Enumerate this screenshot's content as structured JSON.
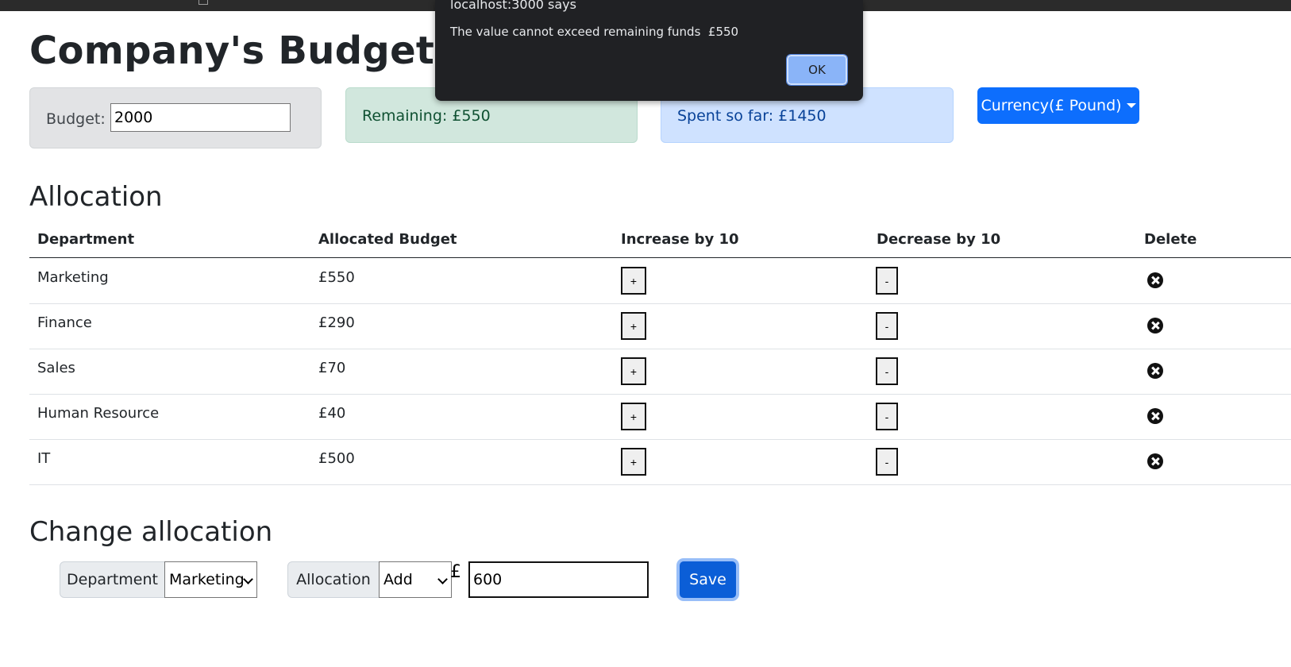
{
  "page": {
    "title": "Company's Budget Allocation"
  },
  "budget": {
    "label": "Budget: £",
    "value": "2000"
  },
  "remaining": {
    "text": "Remaining: £550"
  },
  "spent": {
    "text": "Spent so far: £1450"
  },
  "currency": {
    "label": "Currency(£ Pound)"
  },
  "allocation": {
    "heading": "Allocation",
    "columns": [
      "Department",
      "Allocated Budget",
      "Increase by 10",
      "Decrease by 10",
      "Delete"
    ],
    "rows": [
      {
        "department": "Marketing",
        "budget": "£550",
        "increase": "+",
        "decrease": "-"
      },
      {
        "department": "Finance",
        "budget": "£290",
        "increase": "+",
        "decrease": "-"
      },
      {
        "department": "Sales",
        "budget": "£70",
        "increase": "+",
        "decrease": "-"
      },
      {
        "department": "Human Resource",
        "budget": "£40",
        "increase": "+",
        "decrease": "-"
      },
      {
        "department": "IT",
        "budget": "£500",
        "increase": "+",
        "decrease": "-"
      }
    ]
  },
  "change": {
    "heading": "Change allocation",
    "department_label": "Department",
    "department_value": "Marketing",
    "allocation_label": "Allocation",
    "allocation_value": "Add",
    "currency_symbol": "£",
    "amount": "600",
    "save_label": "Save"
  },
  "dialog": {
    "origin": "localhost:3000 says",
    "message": "The value cannot exceed remaining funds  £550",
    "ok_label": "OK"
  }
}
